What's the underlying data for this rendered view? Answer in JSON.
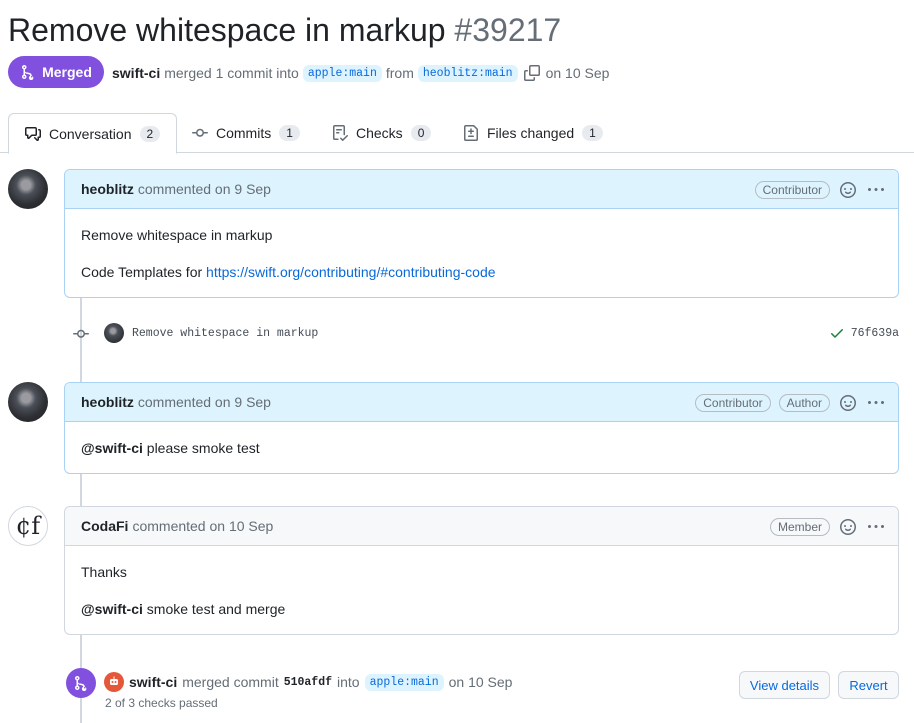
{
  "pr": {
    "title": "Remove whitespace in markup",
    "number": "#39217",
    "state": "Merged",
    "merger": "swift-ci",
    "merged_text": "merged 1 commit into",
    "base_branch": "apple:main",
    "from_text": "from",
    "head_branch": "heoblitz:main",
    "date_text": "on 10 Sep"
  },
  "tabs": [
    {
      "label": "Conversation",
      "count": "2",
      "icon": "comment-discussion-icon"
    },
    {
      "label": "Commits",
      "count": "1",
      "icon": "git-commit-icon"
    },
    {
      "label": "Checks",
      "count": "0",
      "icon": "checklist-icon"
    },
    {
      "label": "Files changed",
      "count": "1",
      "icon": "file-diff-icon"
    }
  ],
  "comments": [
    {
      "author": "heoblitz",
      "action": "commented on 9 Sep",
      "labels": [
        "Contributor"
      ],
      "body": [
        "Remove whitespace in markup"
      ],
      "body_prefix": "Code Templates for ",
      "body_link": "https://swift.org/contributing/#contributing-code"
    },
    {
      "author": "heoblitz",
      "action": "commented on 9 Sep",
      "labels": [
        "Contributor",
        "Author"
      ],
      "mention": "@swift-ci",
      "text": " please smoke test"
    },
    {
      "author": "CodaFi",
      "avatar_text": "¢f",
      "action": "commented on 10 Sep",
      "labels": [
        "Member"
      ],
      "body": [
        "Thanks"
      ],
      "mention": "@swift-ci",
      "text": " smoke test and merge"
    }
  ],
  "commit": {
    "message": "Remove whitespace in markup",
    "sha": "76f639a",
    "status_color": "#1a7f37"
  },
  "merge_event": {
    "actor": "swift-ci",
    "text1": "merged commit",
    "sha": "510afdf",
    "text2": "into",
    "branch": "apple:main",
    "date": "on 10 Sep",
    "checks": "2 of 3 checks passed",
    "view_details": "View details",
    "revert": "Revert"
  },
  "colors": {
    "merged_purple": "#8250df",
    "link_blue": "#0969da",
    "comment_header_blue": "#ddf4ff"
  }
}
